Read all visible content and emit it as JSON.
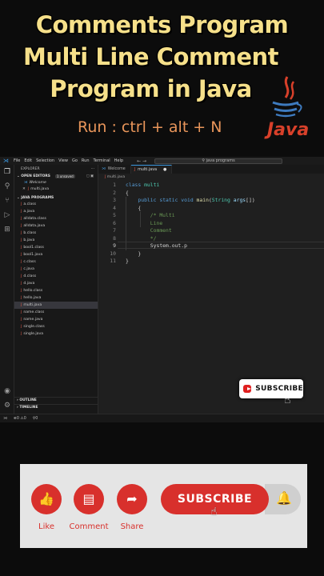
{
  "banner": {
    "title_line1": "Comments Program",
    "title_line2": "Multi Line Comment",
    "title_line3": "Program in Java",
    "run_hint": "Run : ctrl + alt + N",
    "java_logo_text": "Java"
  },
  "vscode": {
    "menu": [
      "File",
      "Edit",
      "Selection",
      "View",
      "Go",
      "Run",
      "Terminal",
      "Help"
    ],
    "search_placeholder": "java programs",
    "explorer": {
      "title": "EXPLORER",
      "open_editors_label": "OPEN EDITORS",
      "unsaved_badge": "1 unsaved",
      "open_editors": [
        {
          "name": "Welcome"
        },
        {
          "name": "multi.java"
        }
      ],
      "project_label": "JAVA PROGRAMS",
      "files": [
        "a.class",
        "a.java",
        "alldata.class",
        "alldata.java",
        "b.class",
        "b.java",
        "bool1.class",
        "bool1.java",
        "c.class",
        "c.java",
        "d.class",
        "d.java",
        "hello.class",
        "hello.java",
        "multi.java",
        "name.class",
        "name.java",
        "single.class",
        "single.java"
      ],
      "outline_label": "OUTLINE",
      "timeline_label": "TIMELINE"
    },
    "tabs": [
      {
        "label": "Welcome"
      },
      {
        "label": "multi.java"
      }
    ],
    "breadcrumb": "multi.java",
    "code_lines": [
      {
        "n": "1",
        "text": "class multi"
      },
      {
        "n": "2",
        "text": "{"
      },
      {
        "n": "3",
        "text": "    public static void main(String args[])"
      },
      {
        "n": "4",
        "text": "    {"
      },
      {
        "n": "5",
        "text": "        /* Multi"
      },
      {
        "n": "6",
        "text": "        Line"
      },
      {
        "n": "7",
        "text": "        Comment"
      },
      {
        "n": "8",
        "text": "        */"
      },
      {
        "n": "9",
        "text": "        System.out.p"
      },
      {
        "n": "10",
        "text": "    }"
      },
      {
        "n": "11",
        "text": "}"
      }
    ],
    "status": {
      "problems": "⊗0 ⚠0",
      "ports": "⚲0"
    }
  },
  "subscribe_overlay": {
    "label": "SUBSCRIBE"
  },
  "action_bar": {
    "like_label": "Like",
    "comment_label": "Comment",
    "share_label": "Share",
    "subscribe_label": "SUBSCRIBE"
  },
  "colors": {
    "title": "#f6e08a",
    "run_hint": "#e8955a",
    "youtube_red": "#d8302c",
    "editor_bg": "#1f1f1f"
  }
}
